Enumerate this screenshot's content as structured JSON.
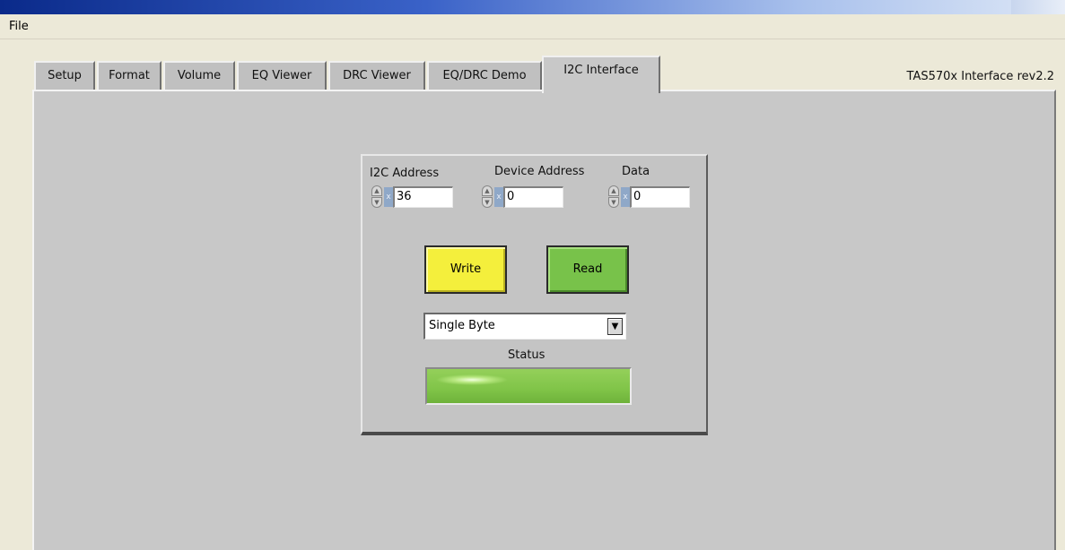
{
  "menu": {
    "file_label": "File"
  },
  "tabs": [
    {
      "label": "Setup"
    },
    {
      "label": "Format"
    },
    {
      "label": "Volume"
    },
    {
      "label": "EQ Viewer"
    },
    {
      "label": "DRC Viewer"
    },
    {
      "label": "EQ/DRC Demo"
    },
    {
      "label": "I2C Interface",
      "active": true
    }
  ],
  "version_label": "TAS570x Interface rev2.2",
  "i2c": {
    "address_label": "I2C Address",
    "address_radix": "x",
    "address_value": "36",
    "device_address_label": "Device Address",
    "device_address_radix": "x",
    "device_address_value": "0",
    "data_label": "Data",
    "data_radix": "x",
    "data_value": "0",
    "write_label": "Write",
    "read_label": "Read",
    "mode_selected": "Single Byte",
    "status_label": "Status",
    "status_color": "#80c448"
  },
  "colors": {
    "write_button": "#f4ef3c",
    "read_button": "#78c24a",
    "panel": "#c8c8c8"
  },
  "icons": {
    "spinner": "spinner-icon",
    "dropdown": "chevron-down-icon"
  }
}
